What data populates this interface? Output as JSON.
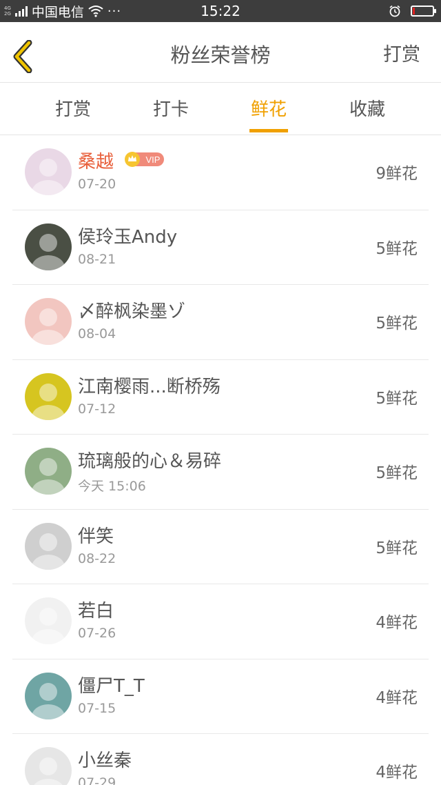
{
  "status_bar": {
    "net_tag_top": "4G",
    "net_tag_bottom": "2G",
    "carrier": "中国电信",
    "more": "···",
    "time": "15:22",
    "battery_level": 0.12
  },
  "header": {
    "title": "粉丝荣誉榜",
    "action_label": "打赏"
  },
  "tabs": [
    {
      "label": "打赏",
      "active": false
    },
    {
      "label": "打卡",
      "active": false
    },
    {
      "label": "鲜花",
      "active": true
    },
    {
      "label": "收藏",
      "active": false
    }
  ],
  "vip_badge_text": "VIP",
  "list": [
    {
      "name": "桑越",
      "date": "07-20",
      "count": "9鲜花",
      "vip": true,
      "avatar_color": "#e9d8e6",
      "avatar_icon": "girl-photo"
    },
    {
      "name": "侯玲玉Andy",
      "date": "08-21",
      "count": "5鲜花",
      "vip": false,
      "avatar_color": "#4a4f44",
      "avatar_icon": "gorilla-photo"
    },
    {
      "name": "〆醉枫染墨ゾ",
      "date": "08-04",
      "count": "5鲜花",
      "vip": false,
      "avatar_color": "#f2c6c0",
      "avatar_icon": "child-photo"
    },
    {
      "name": "江南樱雨...断桥殇",
      "date": "07-12",
      "count": "5鲜花",
      "vip": false,
      "avatar_color": "#d6c520",
      "avatar_icon": "white-dog-photo"
    },
    {
      "name": "琉璃般的心＆易碎",
      "date": "今天 15:06",
      "count": "5鲜花",
      "vip": false,
      "avatar_color": "#8fae86",
      "avatar_icon": "flowers-photo"
    },
    {
      "name": "伴笑",
      "date": "08-22",
      "count": "5鲜花",
      "vip": false,
      "avatar_color": "#cfcfcf",
      "avatar_icon": "clown-photo"
    },
    {
      "name": "若白",
      "date": "07-26",
      "count": "4鲜花",
      "vip": false,
      "avatar_color": "#f1f1f1",
      "avatar_icon": "cartoon-boy-photo"
    },
    {
      "name": "僵尸T_T",
      "date": "07-15",
      "count": "4鲜花",
      "vip": false,
      "avatar_color": "#6fa5a4",
      "avatar_icon": "anime-photo"
    },
    {
      "name": "小丝秦",
      "date": "07-29",
      "count": "4鲜花",
      "vip": false,
      "avatar_color": "#e6e6e6",
      "avatar_icon": "default-avatar"
    }
  ],
  "colors": {
    "accent": "#f0a000",
    "vip_name": "#e8603c",
    "status_bar_bg": "#3d3d3d"
  }
}
